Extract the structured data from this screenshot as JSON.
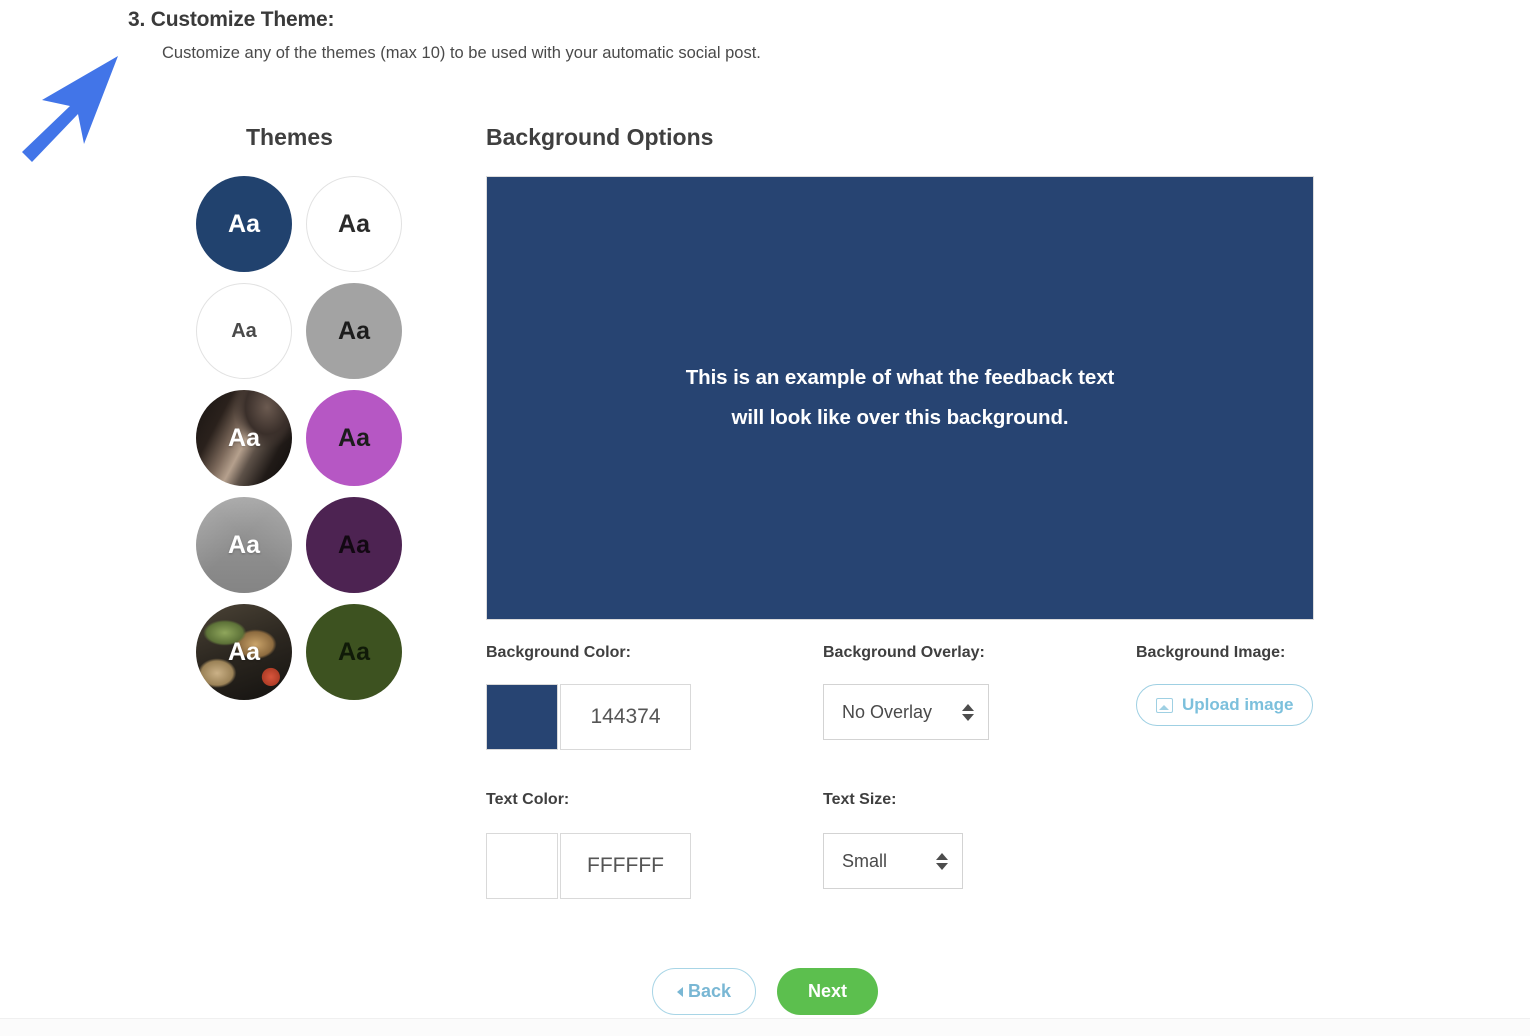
{
  "step": {
    "title": "3. Customize Theme:",
    "subtitle": "Customize any of the themes (max 10) to be used with your automatic social post."
  },
  "cursor": {
    "icon": "arrow-cursor-icon",
    "color": "#4275e8"
  },
  "themes": {
    "heading": "Themes",
    "sample_label": "Aa",
    "items": [
      {
        "name": "theme-navy",
        "kind": "color",
        "color": "#21426e",
        "text_color": "#ffffff",
        "selected": true
      },
      {
        "name": "theme-white-outline",
        "kind": "color",
        "color": "#ffffff",
        "text_color": "#2b2b2b",
        "selected": false
      },
      {
        "name": "theme-white-small",
        "kind": "color",
        "color": "#ffffff",
        "text_color": "#4a4a4a",
        "selected": false
      },
      {
        "name": "theme-gray",
        "kind": "color",
        "color": "#a3a3a3",
        "text_color": "#1c1c1c",
        "selected": false
      },
      {
        "name": "theme-photo-portrait",
        "kind": "photo",
        "photo": "photo-portrait",
        "text_color": "#ffffff",
        "selected": false
      },
      {
        "name": "theme-magenta",
        "kind": "color",
        "color": "#b657c4",
        "text_color": "#1c1c1c",
        "selected": false
      },
      {
        "name": "theme-photo-envelope",
        "kind": "photo",
        "photo": "photo-envelope",
        "text_color": "#ffffff",
        "selected": false
      },
      {
        "name": "theme-dark-purple",
        "kind": "color",
        "color": "#4d2352",
        "text_color": "#120812",
        "selected": false
      },
      {
        "name": "theme-photo-food",
        "kind": "photo",
        "photo": "photo-food",
        "text_color": "#ffffff",
        "selected": false
      },
      {
        "name": "theme-olive-green",
        "kind": "color",
        "color": "#3d5220",
        "text_color": "#101a08",
        "selected": false
      }
    ]
  },
  "background_options": {
    "heading": "Background Options",
    "preview": {
      "line1": "This is an example of what the feedback text",
      "line2": "will look like over this background.",
      "background_color": "#274472",
      "text_color": "#FFFFFF"
    },
    "background_color": {
      "label": "Background Color:",
      "value": "144374",
      "swatch": "#274472"
    },
    "background_overlay": {
      "label": "Background Overlay:",
      "value": "No Overlay"
    },
    "background_image": {
      "label": "Background Image:",
      "upload_label": "Upload image",
      "accent": "#7cc0dc"
    },
    "text_color": {
      "label": "Text Color:",
      "value": "FFFFFF",
      "swatch": "#ffffff"
    },
    "text_size": {
      "label": "Text Size:",
      "value": "Small"
    }
  },
  "navigation": {
    "back_label": "Back",
    "next_label": "Next",
    "next_color": "#5cbf4e",
    "back_color": "#79b7d4"
  }
}
